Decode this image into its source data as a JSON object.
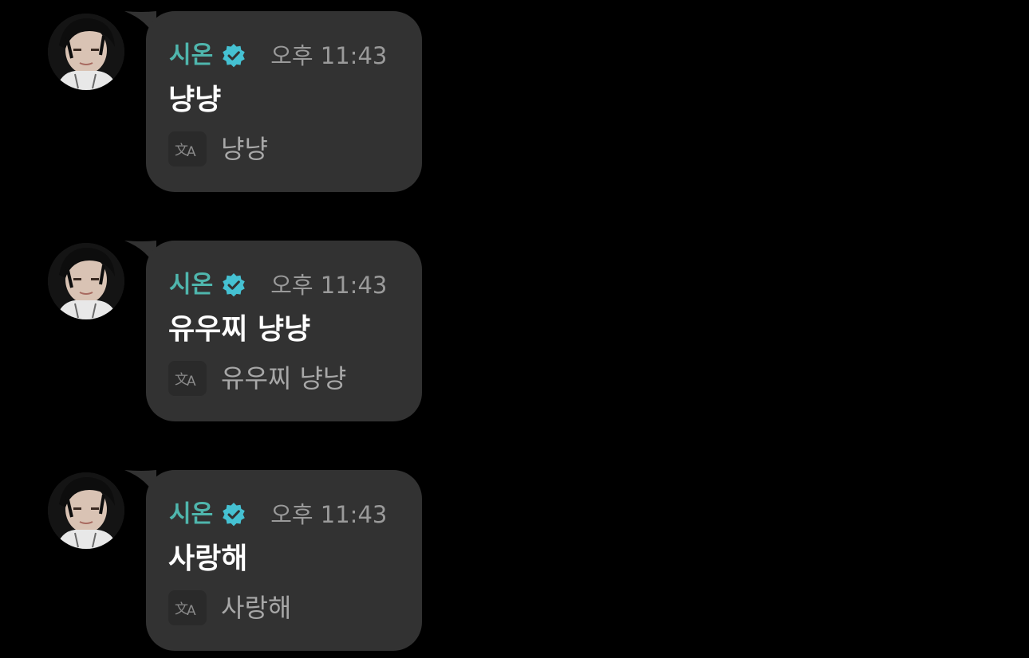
{
  "messages": [
    {
      "sender": "시온",
      "time": "오후 11:43",
      "text": "냥냥",
      "translation": "냥냥"
    },
    {
      "sender": "시온",
      "time": "오후 11:43",
      "text": "유우찌 냥냥",
      "translation": "유우찌 냥냥"
    },
    {
      "sender": "시온",
      "time": "오후 11:43",
      "text": "사랑해",
      "translation": "사랑해"
    }
  ],
  "colors": {
    "background": "#000000",
    "bubble": "#323232",
    "sender_name": "#4fb6ad",
    "verified_badge": "#45c1d2",
    "timestamp": "#9a9a9a",
    "message_text": "#ffffff",
    "translation_text": "#a8a8a8"
  },
  "icons": {
    "avatar": "avatar",
    "verified": "verified-badge-icon",
    "translate": "translate-icon"
  }
}
